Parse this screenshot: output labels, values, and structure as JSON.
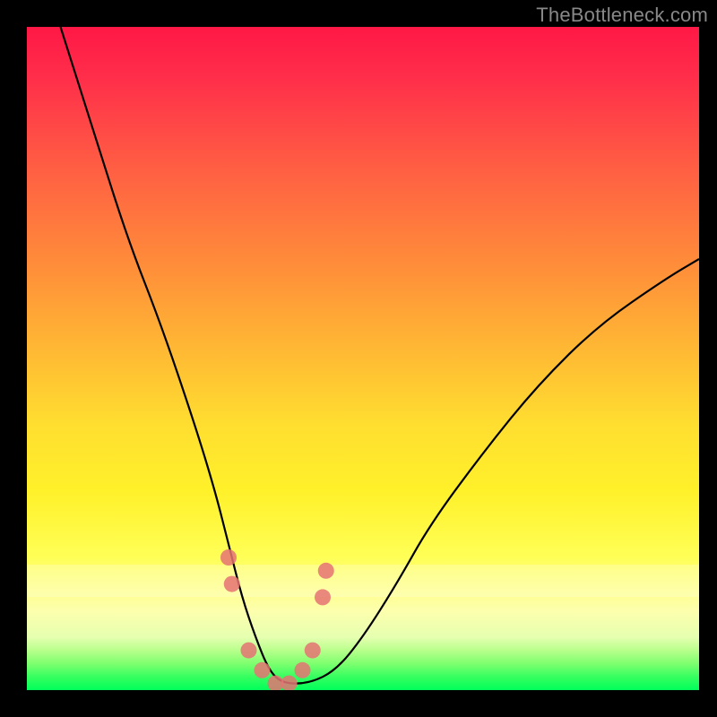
{
  "watermark": "TheBottleneck.com",
  "chart_data": {
    "type": "line",
    "title": "",
    "xlabel": "",
    "ylabel": "",
    "xlim": [
      0,
      100
    ],
    "ylim": [
      0,
      100
    ],
    "background_gradient": {
      "direction": "vertical",
      "stops": [
        {
          "pos": 0,
          "color": "#ff1846",
          "meaning": "bad"
        },
        {
          "pos": 50,
          "color": "#ffde30",
          "meaning": "medium"
        },
        {
          "pos": 88,
          "color": "#fdffad",
          "meaning": "ok"
        },
        {
          "pos": 100,
          "color": "#00ff5a",
          "meaning": "good"
        }
      ]
    },
    "series": [
      {
        "name": "bottleneck-curve",
        "color": "#000000",
        "x": [
          5,
          10,
          15,
          20,
          25,
          28,
          30,
          32,
          34,
          36,
          38,
          42,
          46,
          50,
          55,
          60,
          68,
          76,
          85,
          95,
          100
        ],
        "values": [
          100,
          84,
          68,
          55,
          40,
          30,
          22,
          14,
          8,
          3,
          1,
          1,
          3,
          8,
          16,
          25,
          36,
          46,
          55,
          62,
          65
        ]
      }
    ],
    "markers": {
      "name": "valley-dots",
      "color": "#e57373",
      "x": [
        30,
        30.5,
        33,
        35,
        37,
        39,
        41,
        42.5,
        44,
        44.5
      ],
      "values": [
        20,
        16,
        6,
        3,
        1,
        1,
        3,
        6,
        14,
        18
      ]
    }
  }
}
